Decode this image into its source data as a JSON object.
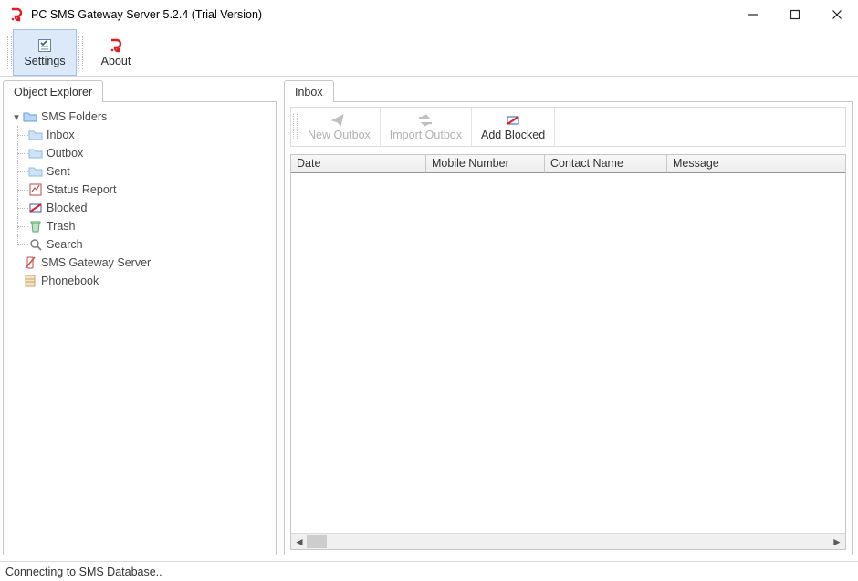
{
  "window": {
    "title": "PC SMS Gateway Server 5.2.4 (Trial Version)"
  },
  "toolbar": {
    "settings": "Settings",
    "about": "About"
  },
  "left_tab": "Object Explorer",
  "tree": {
    "root": "SMS Folders",
    "inbox": "Inbox",
    "outbox": "Outbox",
    "sent": "Sent",
    "status_report": "Status Report",
    "blocked": "Blocked",
    "trash": "Trash",
    "search": "Search",
    "gateway": "SMS Gateway Server",
    "phonebook": "Phonebook"
  },
  "right_tab": "Inbox",
  "inner_toolbar": {
    "new_outbox": "New Outbox",
    "import_outbox": "Import Outbox",
    "add_blocked": "Add Blocked"
  },
  "grid": {
    "date": "Date",
    "mobile": "Mobile Number",
    "contact": "Contact Name",
    "message": "Message"
  },
  "status": "Connecting to SMS Database.."
}
